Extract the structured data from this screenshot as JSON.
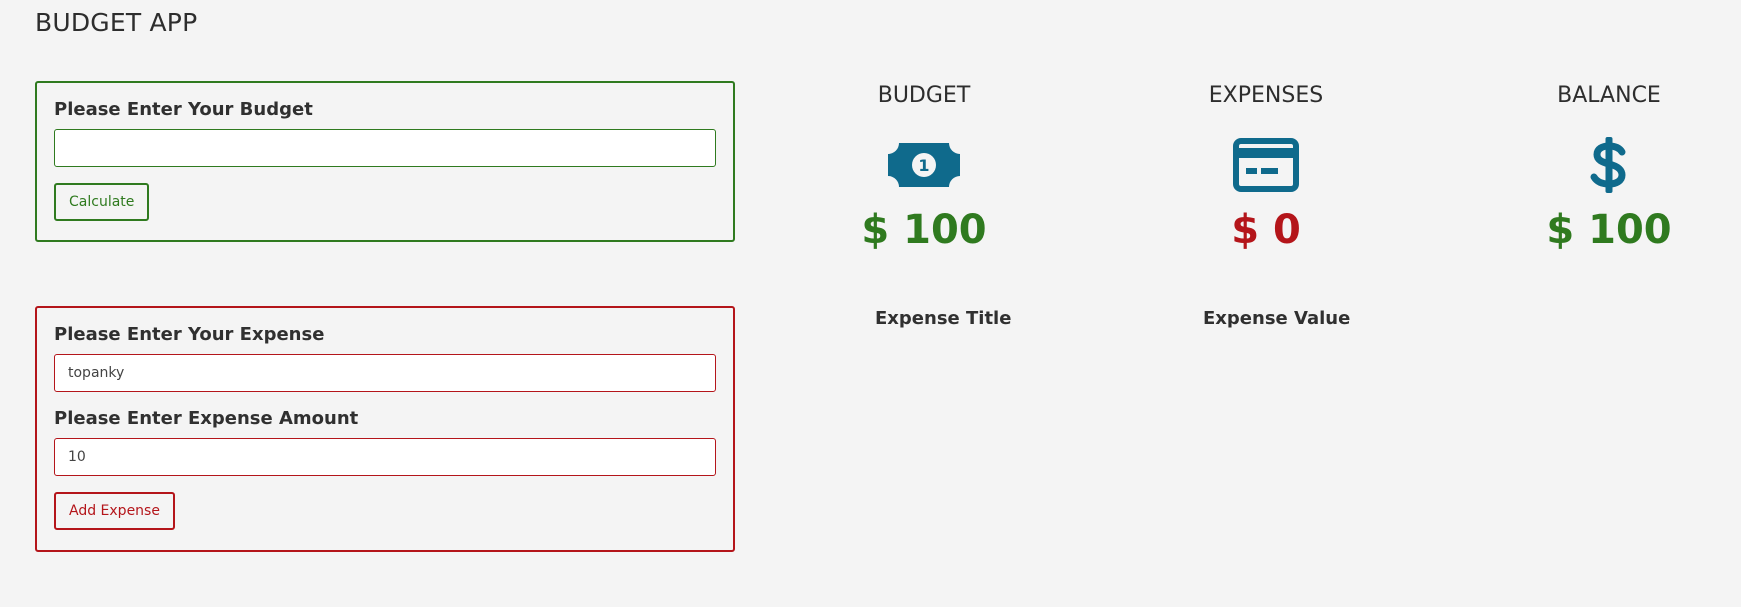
{
  "app": {
    "title": "BUDGET APP"
  },
  "budget_form": {
    "label": "Please Enter Your Budget",
    "input_value": "",
    "button_label": "Calculate"
  },
  "expense_form": {
    "title_label": "Please Enter Your Expense",
    "title_value": "topanky",
    "amount_label": "Please Enter Expense Amount",
    "amount_value": "10",
    "button_label": "Add Expense"
  },
  "stats": {
    "budget": {
      "title": "BUDGET",
      "icon": "money-bill-icon",
      "amount": "$ 100"
    },
    "expenses": {
      "title": "EXPENSES",
      "icon": "credit-card-icon",
      "amount": "$ 0"
    },
    "balance": {
      "title": "BALANCE",
      "icon": "dollar-sign-icon",
      "amount": "$ 100"
    }
  },
  "expense_list": {
    "headers": [
      "Expense Title",
      "Expense Value"
    ]
  },
  "colors": {
    "green": "#2f7a1f",
    "red": "#b4151a",
    "icon_blue": "#0f6a8c",
    "background": "#f4f4f4"
  }
}
